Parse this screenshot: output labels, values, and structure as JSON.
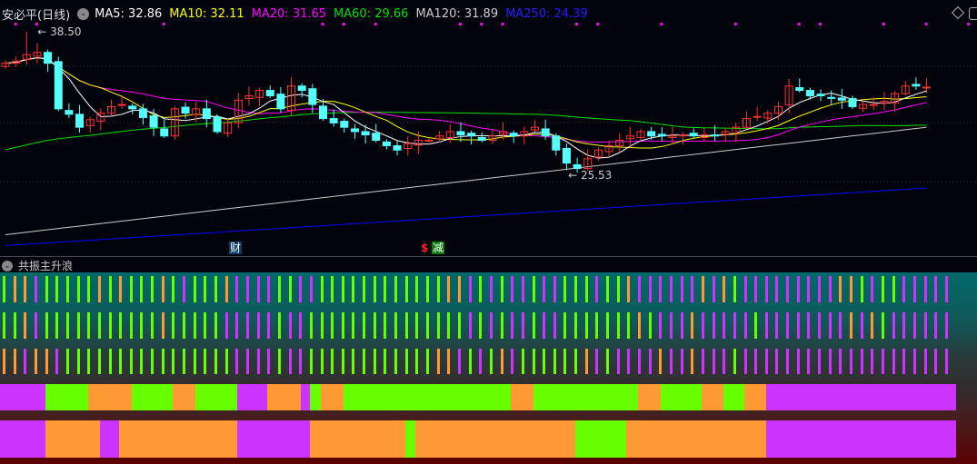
{
  "header": {
    "stock_name": "安必平(日线)",
    "ma5": "MA5: 32.86",
    "ma10": "MA10: 32.11",
    "ma20": "MA20: 31.65",
    "ma60": "MA60: 29.66",
    "ma120": "MA120: 31.89",
    "ma250": "MA250: 24.39"
  },
  "colors": {
    "ma5": "#ffffff",
    "ma10": "#ffff00",
    "ma20": "#ff00ff",
    "ma60": "#00e000",
    "ma120": "#cccccc",
    "ma250": "#0000ff",
    "up": "#ff3030",
    "down": "#54ffff",
    "green": "#66ff00",
    "orange": "#ff9933",
    "magenta": "#cc33ff"
  },
  "annotations": {
    "high_label": "38.50",
    "low_label": "25.53",
    "event_cai": "财",
    "event_s": "$",
    "event_jian": "减"
  },
  "indicator": {
    "title": "共振主升浪",
    "rows": [
      "GOOMGGGGGOGOGGGOGMGGGOMMMMGGMMGGGGGGGGGGGGOOMGMGMMGMMGGGMGGOMMMMMMOMOGMMMMMMMMMOOGMGGMMMMM",
      "GGOMGGGGGGGGGGGOGGGGGMMMMMGMMGGGGGGGGGGGGGGGMGMGMMGMMGGGGGGGOGMMMOMMMMMGMMMMMMMMOMOGMMMMMM",
      "OOMOOMGGGGGGGGGGGGGGGGMMMMGMMGGGGGGGGGGGGOOMGMGOMGGGGGGOMGMMMMOMMOMMMGMMMMMMMMMMMMMMMMMMMM"
    ],
    "band1": [
      [
        "M",
        0,
        50
      ],
      [
        "G",
        50,
        97
      ],
      [
        "O",
        97,
        145
      ],
      [
        "G",
        145,
        190
      ],
      [
        "O",
        190,
        215
      ],
      [
        "G",
        215,
        261
      ],
      [
        "M",
        261,
        294
      ],
      [
        "O",
        294,
        331
      ],
      [
        "M",
        331,
        341
      ],
      [
        "G",
        341,
        353
      ],
      [
        "O",
        353,
        378
      ],
      [
        "G",
        378,
        562
      ],
      [
        "O",
        562,
        587
      ],
      [
        "G",
        587,
        702
      ],
      [
        "O",
        702,
        727
      ],
      [
        "G",
        727,
        772
      ],
      [
        "O",
        772,
        796
      ],
      [
        "G",
        796,
        819
      ],
      [
        "O",
        819,
        843
      ],
      [
        "M",
        843,
        1052
      ]
    ],
    "band2": [
      [
        "M",
        0,
        50
      ],
      [
        "O",
        50,
        110
      ],
      [
        "M",
        110,
        131
      ],
      [
        "O",
        131,
        261
      ],
      [
        "M",
        261,
        341
      ],
      [
        "O",
        341,
        446
      ],
      [
        "G",
        446,
        457
      ],
      [
        "O",
        457,
        633
      ],
      [
        "G",
        633,
        689
      ],
      [
        "O",
        689,
        843
      ],
      [
        "M",
        843,
        1052
      ]
    ]
  },
  "chart_data": {
    "type": "candlestick",
    "price_range": [
      18.5,
      41.4
    ],
    "closes": [
      35.6,
      35.8,
      36.4,
      36.6,
      35.6,
      31.4,
      30.9,
      29.7,
      30.4,
      31.0,
      31.6,
      31.8,
      31.4,
      30.6,
      29.7,
      28.9,
      31.4,
      31.0,
      31.4,
      30.5,
      29.3,
      30.1,
      32.2,
      32.6,
      33.1,
      32.6,
      31.4,
      33.5,
      33.1,
      31.8,
      30.5,
      30.1,
      29.7,
      29.3,
      29.0,
      28.5,
      28.0,
      27.6,
      28.2,
      28.5,
      28.5,
      28.9,
      29.3,
      29.0,
      28.9,
      28.5,
      28.9,
      29.3,
      28.9,
      29.3,
      29.7,
      28.9,
      27.6,
      26.4,
      25.9,
      26.8,
      27.6,
      28.0,
      28.5,
      28.9,
      29.3,
      28.9,
      28.9,
      28.9,
      29.0,
      28.9,
      29.0,
      28.9,
      29.3,
      29.7,
      30.5,
      30.7,
      31.0,
      31.6,
      33.5,
      33.1,
      32.6,
      32.6,
      32.4,
      32.2,
      31.6,
      31.8,
      31.8,
      32.1,
      32.8,
      33.5,
      33.5,
      33.4
    ],
    "extremes": {
      "high": 38.5,
      "low": 25.53
    },
    "ma120": [
      19.8,
      29.7
    ],
    "ma250": [
      18.8,
      24.1
    ],
    "top_marker_bars": [
      1,
      3,
      15,
      30,
      32,
      35,
      43,
      45,
      47,
      54,
      56,
      62,
      69,
      75,
      77,
      83,
      87,
      91,
      95
    ]
  }
}
